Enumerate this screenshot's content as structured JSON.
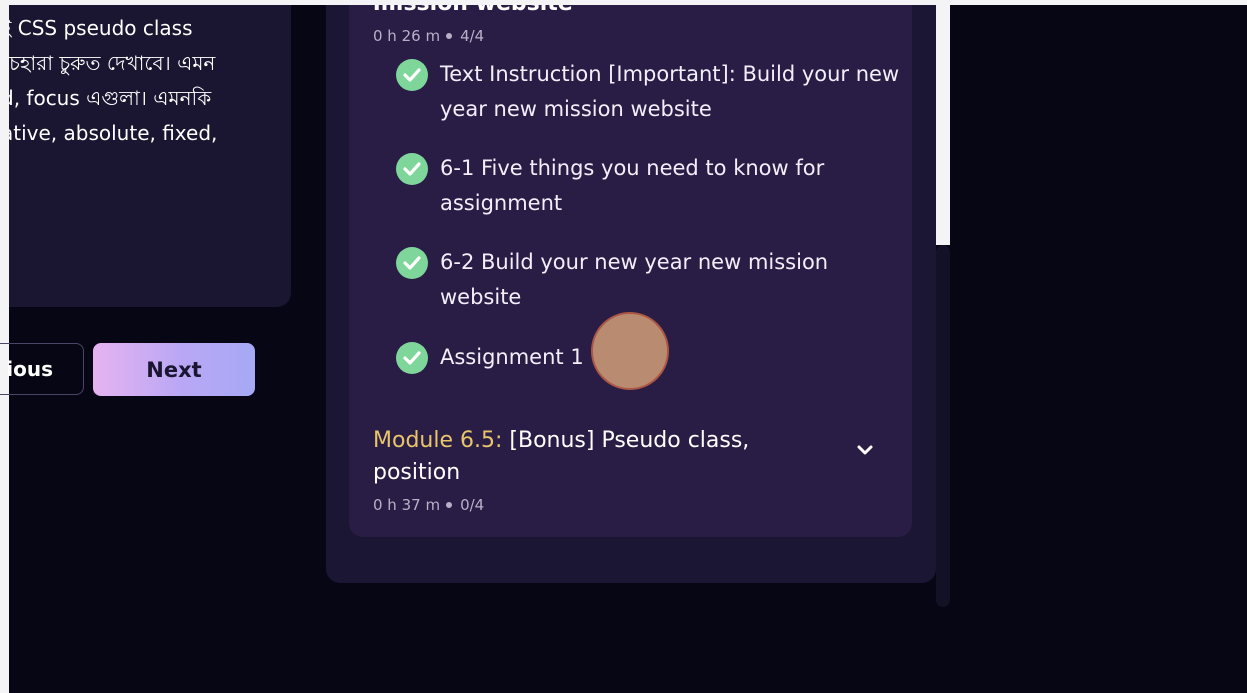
{
  "description": {
    "lines": [
      "ই CSS pseudo class",
      "চেহারা চুরুত দেখাবে। এমন",
      "d, focus এগুলা। এমনকি",
      "ative, absolute, fixed,"
    ]
  },
  "nav": {
    "previous_label": "ious",
    "next_label": "Next"
  },
  "current_module": {
    "title_partial": "mission website",
    "duration": "0 h 26 m",
    "progress": "4/4",
    "lessons": [
      {
        "label": "Text Instruction [Important]: Build your new year new mission website",
        "completed": true
      },
      {
        "label": "6-1 Five things you need to know for assignment",
        "completed": true
      },
      {
        "label": "6-2 Build your new year new mission website",
        "completed": true
      },
      {
        "label": "Assignment 1",
        "completed": true
      }
    ]
  },
  "next_module": {
    "number": "Module 6.5:",
    "title": "[Bonus] Pseudo class, position",
    "duration": "0 h 37 m",
    "progress": "0/4"
  },
  "icons": {
    "check": "check-circle-icon",
    "expand": "chevron-down-icon"
  },
  "colors": {
    "accent_check": "#7fd69a",
    "module_number": "#e8c56a",
    "card_bg": "#2a1d45",
    "page_bg": "#070614"
  }
}
